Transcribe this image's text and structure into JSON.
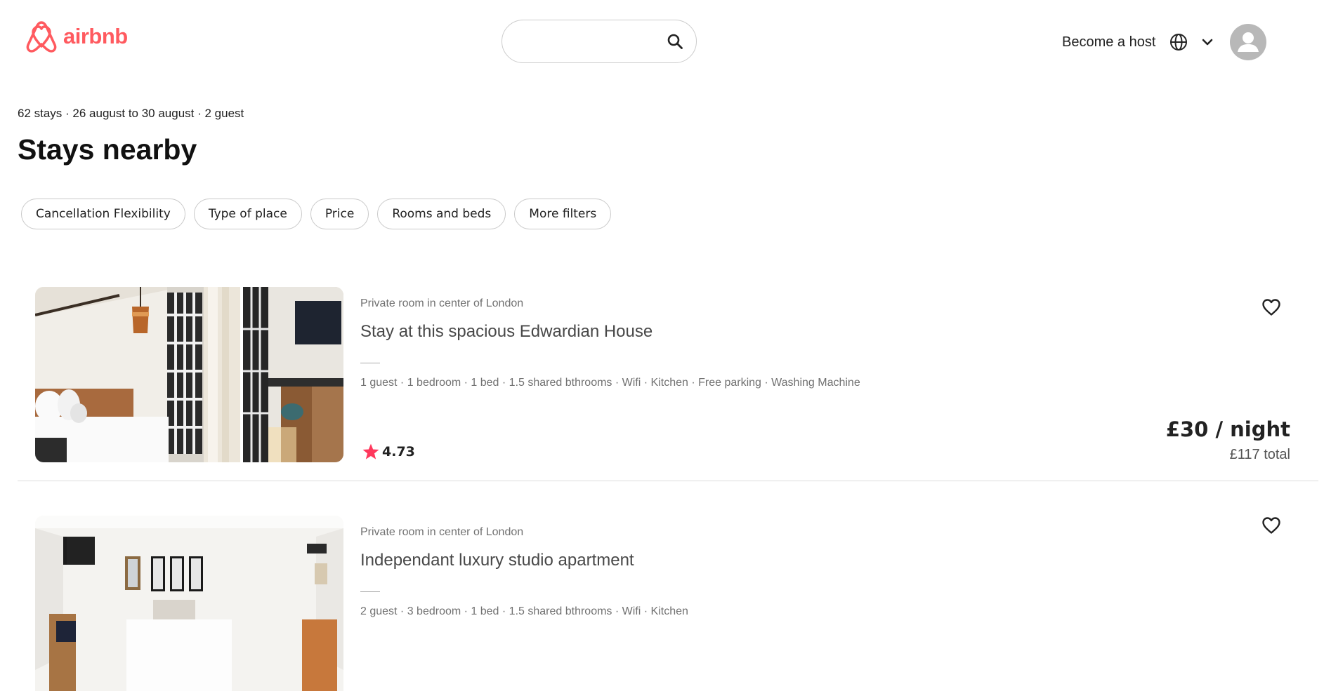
{
  "header": {
    "logo_text": "airbnb",
    "brand_color": "#ff5a5f",
    "search": {
      "placeholder": "",
      "icon": "search-icon"
    },
    "become_host_label": "Become a host",
    "globe_icon": "globe-icon",
    "chevron_icon": "chevron-down-icon",
    "avatar_icon": "user-avatar-icon"
  },
  "results": {
    "summary": "62 stays · 26 august to 30 august · 2 guest",
    "title": "Stays nearby"
  },
  "filters": [
    {
      "label": "Cancellation Flexibility"
    },
    {
      "label": "Type of place"
    },
    {
      "label": "Price"
    },
    {
      "label": "Rooms and beds"
    },
    {
      "label": "More filters"
    }
  ],
  "listings": [
    {
      "subtype": "Private room in center of London",
      "title": "Stay at this spacious Edwardian House",
      "amenities": "1 guest · 1 bedroom · 1 bed · 1.5 shared bthrooms · Wifi · Kitchen · Free parking · Washing Machine",
      "rating": "4.73",
      "price_per_night": "£30 / night",
      "total": "£117 total",
      "star_color": "#ff385c"
    },
    {
      "subtype": "Private room in center of London",
      "title": "Independant luxury studio apartment",
      "amenities": "2 guest · 3 bedroom · 1 bed · 1.5 shared bthrooms · Wifi · Kitchen"
    }
  ]
}
